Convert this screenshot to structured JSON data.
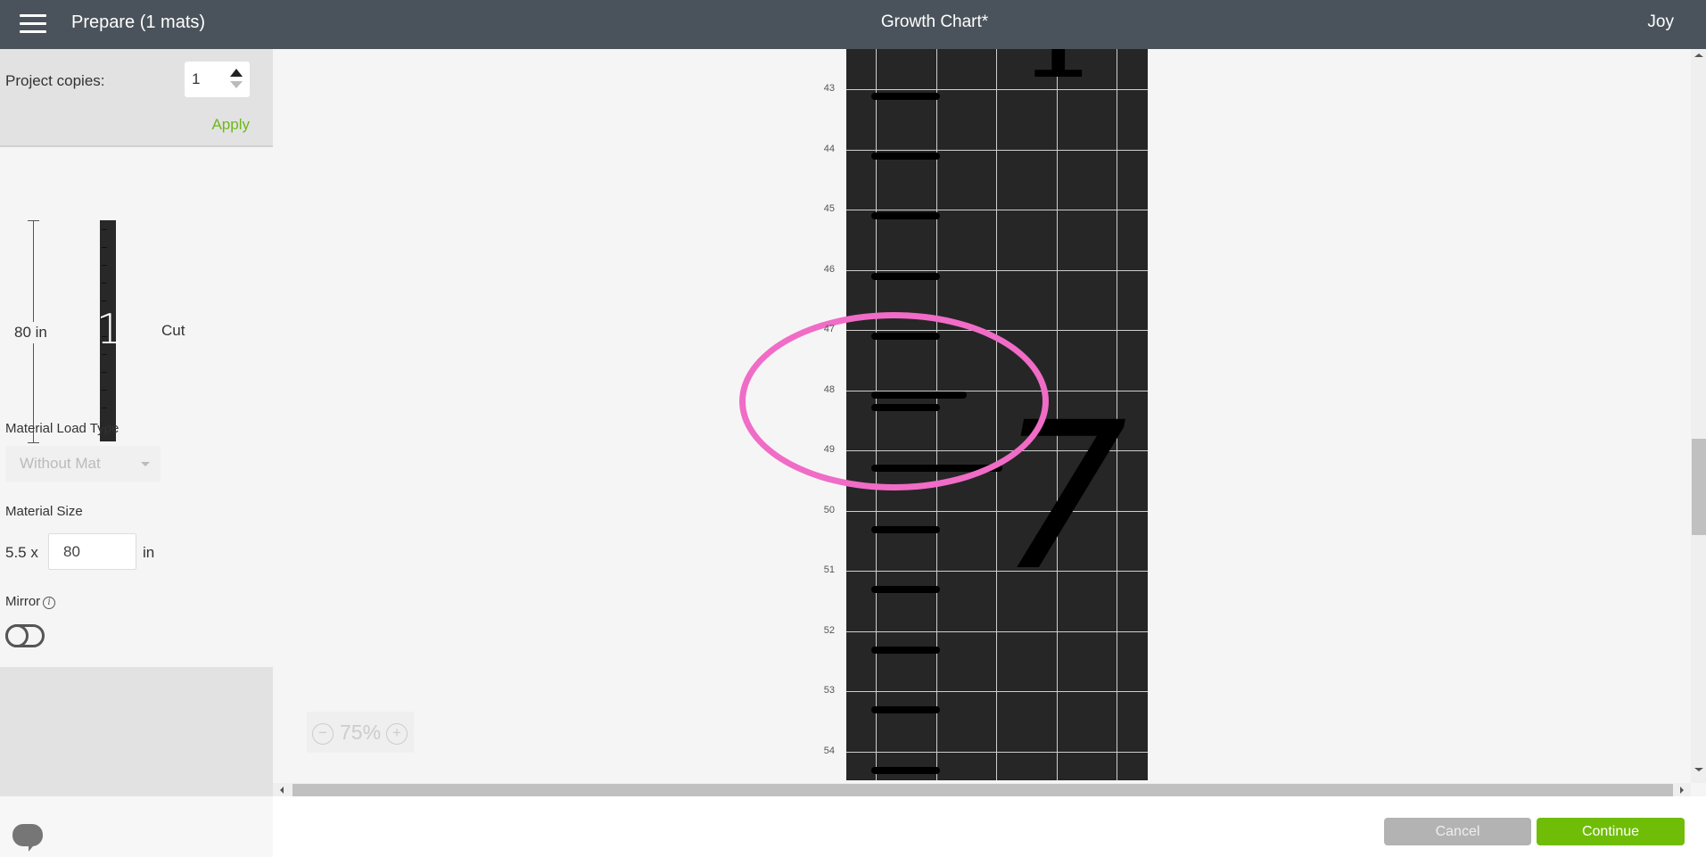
{
  "header": {
    "menu_icon": "hamburger-icon",
    "title": "Prepare (1 mats)",
    "project_name": "Growth Chart*",
    "user_name": "Joy"
  },
  "sidebar": {
    "copies": {
      "label": "Project copies:",
      "value": "1",
      "apply_label": "Apply"
    },
    "mat_preview": {
      "length_label": "80 in",
      "mat_number": "1",
      "mat_label": "Cut"
    },
    "material_load_type": {
      "label": "Material Load Type",
      "selected": "Without Mat"
    },
    "material_size": {
      "label": "Material Size",
      "width_prefix": "5.5 x",
      "length_value": "80",
      "unit": "in"
    },
    "mirror": {
      "label": "Mirror",
      "info_icon": "i",
      "enabled": false
    }
  },
  "canvas": {
    "ruler_labels": [
      "43",
      "44",
      "45",
      "46",
      "47",
      "48",
      "49",
      "50",
      "51",
      "52",
      "53",
      "54"
    ],
    "digits": {
      "top": "1",
      "middle": "7"
    },
    "zoom": {
      "minus": "−",
      "value": "75%",
      "plus": "+"
    }
  },
  "footer": {
    "cancel_label": "Cancel",
    "continue_label": "Continue"
  },
  "colors": {
    "header_bg": "#4a535b",
    "accent_green": "#6fbd07",
    "highlight_pink": "#f06cc6",
    "mat_bg": "#262626"
  }
}
